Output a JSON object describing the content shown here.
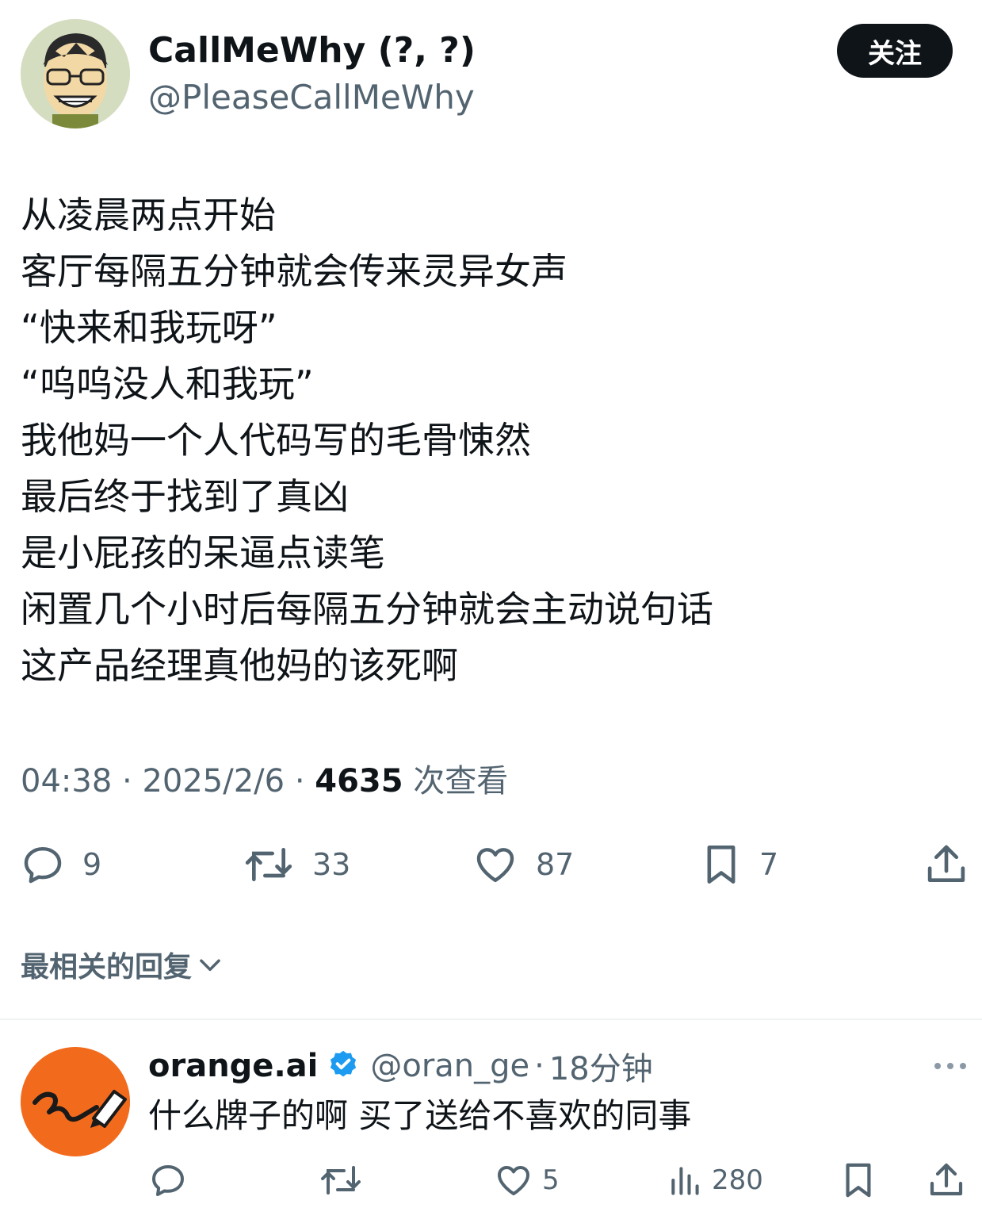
{
  "tweet": {
    "author_name": "CallMeWhy (?, ?)",
    "author_handle": "@PleaseCallMeWhy",
    "follow_label": "关注",
    "lines": [
      "从凌晨两点开始",
      "客厅每隔五分钟就会传来灵异女声",
      "“快来和我玩呀”",
      "“呜呜没人和我玩”",
      "我他妈一个人代码写的毛骨悚然",
      "最后终于找到了真凶",
      "是小屁孩的呆逼点读笔",
      "闲置几个小时后每隔五分钟就会主动说句话",
      "这产品经理真他妈的该死啊"
    ],
    "time": "04:38",
    "sep": "·",
    "date": "2025/2/6",
    "views_count": "4635",
    "views_label": "次查看",
    "actions": {
      "replies": "9",
      "retweets": "33",
      "likes": "87",
      "bookmarks": "7"
    }
  },
  "replies_header": "最相关的回复",
  "reply": {
    "name": "orange.ai",
    "handle": "@oran_ge",
    "sep": "·",
    "time": "18分钟",
    "text": "什么牌子的啊 买了送给不喜欢的同事",
    "likes": "5",
    "views": "280"
  },
  "icons": {
    "reply": "reply-icon",
    "retweet": "retweet-icon",
    "like": "heart-icon",
    "bookmark": "bookmark-icon",
    "share": "share-icon",
    "views": "views-icon",
    "verified": "verified-badge-icon",
    "more": "more-icon",
    "chevron": "chevron-down-icon"
  },
  "colors": {
    "text": "#0f1419",
    "secondary": "#536471",
    "verified": "#1d9bf0",
    "orange_avatar": "#f26b1d"
  }
}
